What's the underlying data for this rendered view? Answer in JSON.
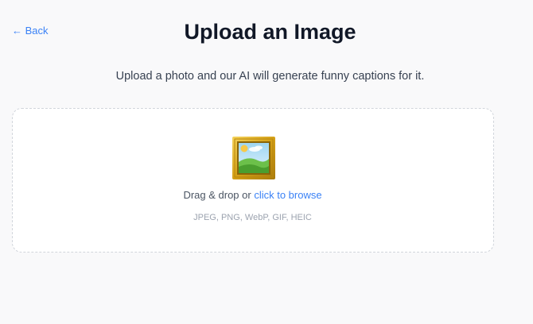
{
  "header": {
    "back_label": "← Back",
    "title": "Upload an Image"
  },
  "subtitle": "Upload a photo and our AI will generate funny captions for it.",
  "dropzone": {
    "icon": "framed-picture-icon",
    "drag_text": "Drag & drop or ",
    "browse_label": "click to browse",
    "formats": "JPEG, PNG, WebP, GIF, HEIC"
  },
  "colors": {
    "link": "#3b82f6",
    "title": "#111827",
    "background": "#f9f9fa",
    "frame_gold": "#d4a017"
  }
}
